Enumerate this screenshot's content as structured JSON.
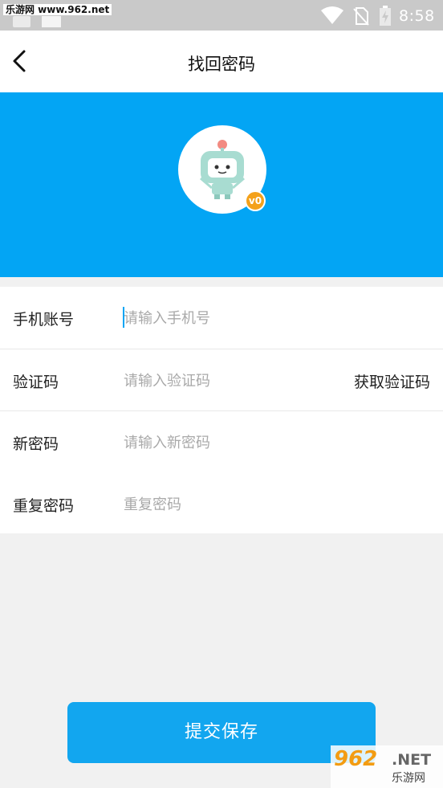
{
  "status_bar": {
    "watermark": "乐游网 www.962.net",
    "time": "8:58",
    "icons": [
      "wifi-icon",
      "no-sim-icon",
      "battery-charging-icon"
    ]
  },
  "header": {
    "back_icon": "chevron-left-icon",
    "title": "找回密码"
  },
  "profile": {
    "badge": "v0",
    "colors": {
      "banner": "#03a5f4",
      "badge": "#f4a11a"
    }
  },
  "form": {
    "phone": {
      "label": "手机账号",
      "placeholder": "请输入手机号",
      "value": ""
    },
    "code": {
      "label": "验证码",
      "placeholder": "请输入验证码",
      "value": "",
      "action": "获取验证码"
    },
    "new_password": {
      "label": "新密码",
      "placeholder": "请输入新密码",
      "value": ""
    },
    "repeat_password": {
      "label": "重复密码",
      "placeholder": "重复密码",
      "value": ""
    }
  },
  "submit": {
    "label": "提交保存",
    "color": "#12a6ef"
  },
  "watermark_br": {
    "number": "962",
    "net": ".NET",
    "cn": "乐游网"
  }
}
